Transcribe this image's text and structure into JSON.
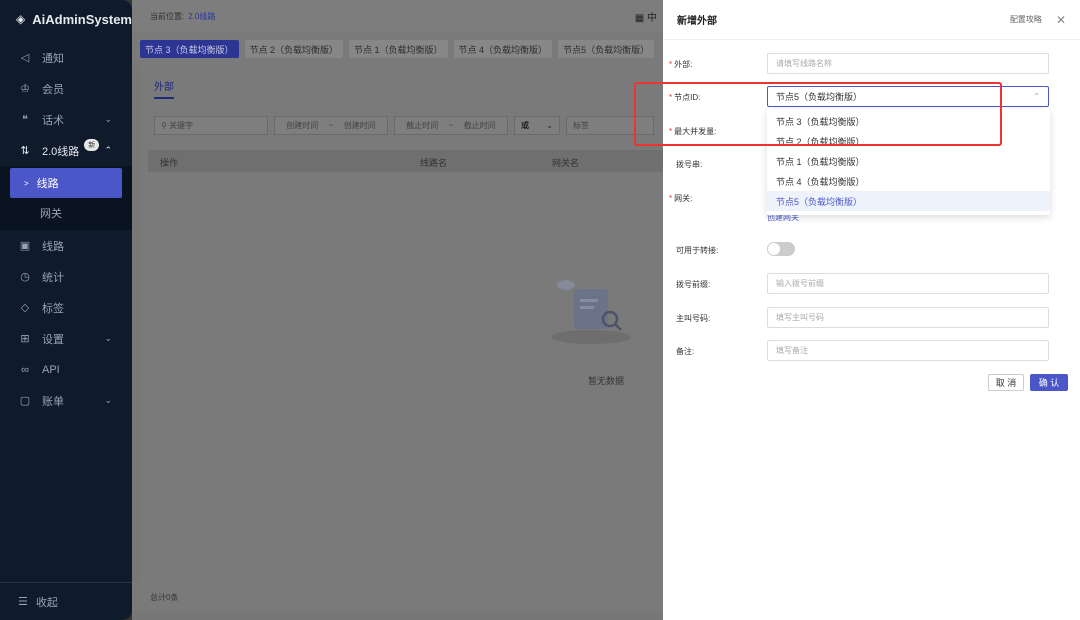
{
  "app": {
    "title": "AiAdminSystem"
  },
  "sidebar": {
    "items": [
      {
        "label": "通知",
        "icon": "speaker-icon"
      },
      {
        "label": "会员",
        "icon": "crown-icon"
      },
      {
        "label": "话术",
        "icon": "quote-icon"
      },
      {
        "label": "2.0线路",
        "icon": "sort-icon",
        "badge": "新"
      },
      {
        "label": "线路",
        "icon": "monitor-icon"
      },
      {
        "label": "统计",
        "icon": "clock-icon"
      },
      {
        "label": "标签",
        "icon": "tag-icon"
      },
      {
        "label": "设置",
        "icon": "grid-icon"
      },
      {
        "label": "API",
        "icon": "link-icon"
      },
      {
        "label": "账单",
        "icon": "wallet-icon"
      }
    ],
    "sub_items": [
      {
        "label": "线路"
      },
      {
        "label": "网关"
      }
    ],
    "collapse_label": "收起"
  },
  "topbar": {
    "location_label": "当前位置:",
    "crumb": "2.0线路",
    "right_text": "中"
  },
  "node_tabs": [
    "节点 3（负载均衡版）",
    "节点 2（负载均衡版）",
    "节点 1（负载均衡版）",
    "节点 4（负载均衡版）",
    "节点5（负载均衡版）"
  ],
  "panel": {
    "tab": "外部",
    "filters": {
      "keyword": "关键字",
      "create_from": "创建时间",
      "create_to": "创建时间",
      "end_from": "截止时间",
      "end_to": "截止时间",
      "logic": "或",
      "tag": "标签"
    },
    "columns": [
      "操作",
      "线路名",
      "网关名"
    ],
    "empty_text": "暂无数据",
    "footer": "总计0条"
  },
  "drawer": {
    "title": "新增外部",
    "guide": "配置攻略",
    "fields": {
      "external": {
        "label": "外部:",
        "placeholder": "请填写线路名称"
      },
      "node_id": {
        "label": "节点ID:",
        "value": "节点5（负载均衡版）"
      },
      "max_concurrency": {
        "label": "最大并发量:"
      },
      "dial_string": {
        "label": "拨号串:"
      },
      "gateway": {
        "label": "网关:",
        "link": "创建网关"
      },
      "transfer": {
        "label": "可用于转接:"
      },
      "dial_prefix": {
        "label": "拨号前缀:",
        "placeholder": "输入拨号前缀"
      },
      "caller_number": {
        "label": "主叫号码:",
        "placeholder": "填写主叫号码"
      },
      "remark": {
        "label": "备注:",
        "placeholder": "填写备注"
      }
    },
    "cancel": "取 消",
    "confirm": "确 认"
  },
  "dropdown": {
    "options": [
      "节点 3（负载均衡版）",
      "节点 2（负载均衡版）",
      "节点 1（负载均衡版）",
      "节点 4（负载均衡版）",
      "节点5（负载均衡版）"
    ],
    "selected_index": 4
  },
  "colors": {
    "accent": "#4b57c9",
    "sidebar": "#0f1a2b",
    "highlight": "#e33333"
  }
}
